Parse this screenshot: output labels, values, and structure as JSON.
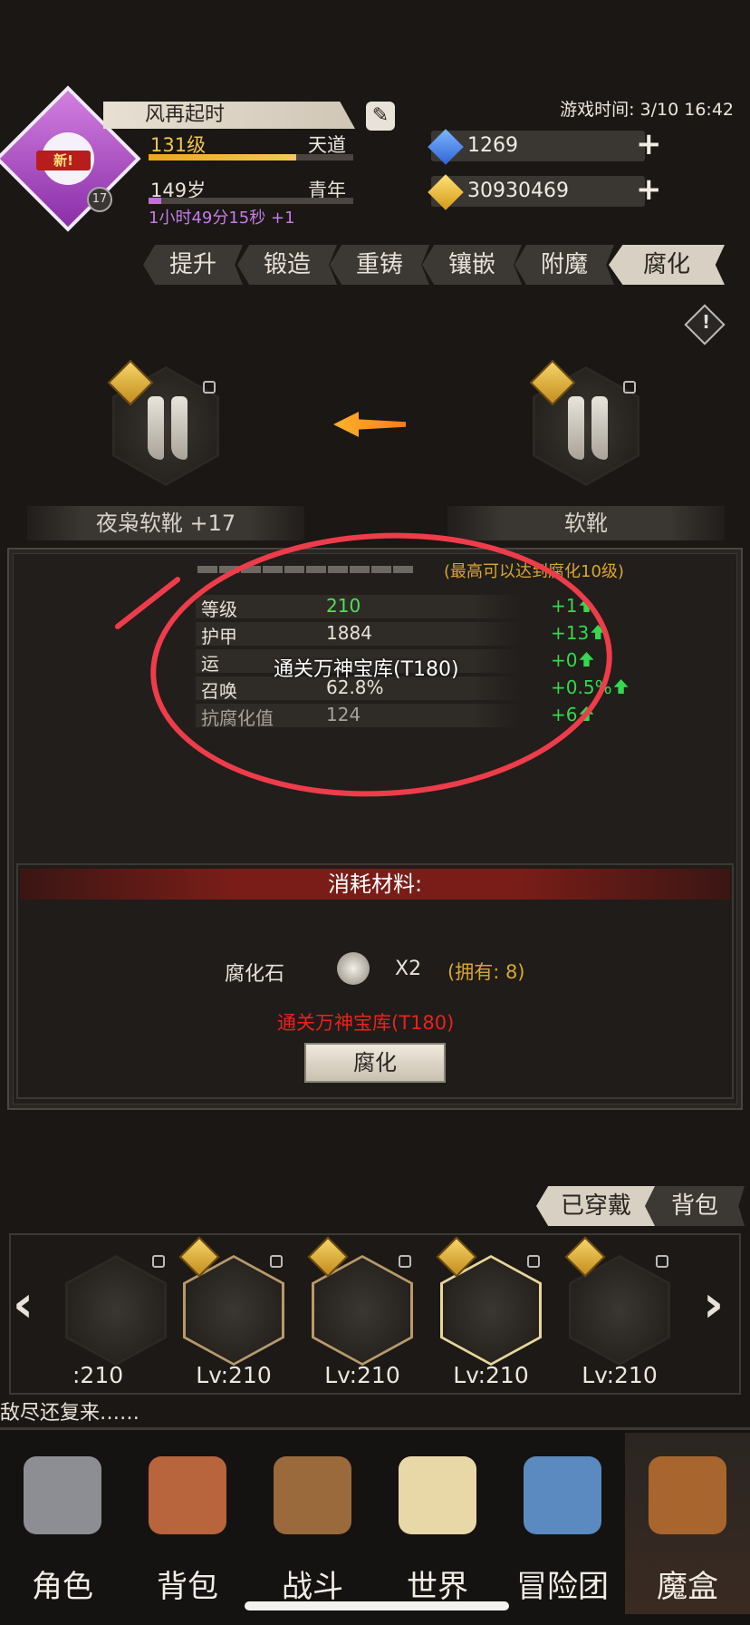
{
  "header": {
    "player_name": "风再起时",
    "level_label": "131级",
    "realm": "天道",
    "level_progress": 0.72,
    "age_label": "149岁",
    "age_stage": "青年",
    "age_progress": 0.06,
    "timer_text": "1小时49分15秒 +1",
    "new_badge": "新!",
    "avatar_level": "17",
    "game_time": "游戏时间: 3/10 16:42",
    "diamonds": "1269",
    "gold": "30930469"
  },
  "tabs": [
    "提升",
    "锻造",
    "重铸",
    "镶嵌",
    "附魔",
    "腐化"
  ],
  "active_tab": "腐化",
  "items": {
    "current_name": "夜枭软靴 +17",
    "target_name": "软靴"
  },
  "corrupt": {
    "max_note": "(最高可以达到腐化10级)",
    "stats": [
      {
        "label": "等级",
        "value": "210",
        "delta": "+1"
      },
      {
        "label": "护甲",
        "value": "1884",
        "delta": "+13"
      },
      {
        "label": "运",
        "value": "",
        "delta": "+0"
      },
      {
        "label": "召唤",
        "value": "62.8%",
        "delta": "+0.5%"
      },
      {
        "label": "抗腐化值",
        "value": "124",
        "delta": "+6"
      }
    ],
    "tooltip": "通关万神宝库(T180)"
  },
  "materials": {
    "header": "消耗材料:",
    "name": "腐化石",
    "qty": "X2",
    "owned": "(拥有: 8)",
    "requirement": "通关万神宝库(T180)",
    "button": "腐化"
  },
  "equip_tabs": {
    "equipped": "已穿戴",
    "bag": "背包"
  },
  "equip_items": [
    {
      "level": ":210"
    },
    {
      "level": "Lv:210"
    },
    {
      "level": "Lv:210"
    },
    {
      "level": "Lv:210"
    },
    {
      "level": "Lv:210"
    }
  ],
  "ticker": "敌尽还复来……",
  "nav": [
    "角色",
    "背包",
    "战斗",
    "世界",
    "冒险团",
    "魔盒"
  ],
  "colors": {
    "accent_gold": "#f2a322",
    "delta_green": "#35d84e",
    "alert_red": "#e8231f",
    "annotation_red": "#ef3c4a"
  }
}
